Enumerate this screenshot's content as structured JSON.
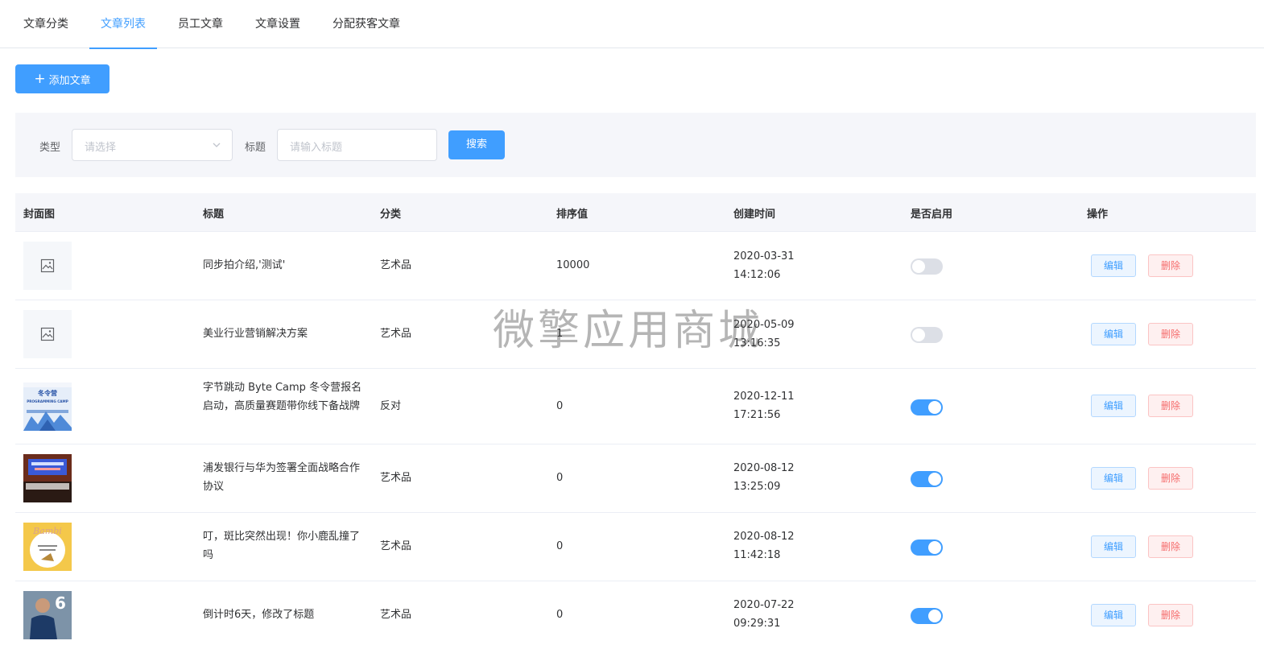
{
  "tabs": [
    {
      "label": "文章分类",
      "active": false
    },
    {
      "label": "文章列表",
      "active": true
    },
    {
      "label": "员工文章",
      "active": false
    },
    {
      "label": "文章设置",
      "active": false
    },
    {
      "label": "分配获客文章",
      "active": false
    }
  ],
  "toolbar": {
    "add_label": "添加文章",
    "add_icon": "plus-icon"
  },
  "filter": {
    "type_label": "类型",
    "type_placeholder": "请选择",
    "title_label": "标题",
    "title_placeholder": "请输入标题",
    "search_label": "搜索"
  },
  "table": {
    "columns": [
      "封面图",
      "标题",
      "分类",
      "排序值",
      "创建时间",
      "是否启用",
      "操作"
    ],
    "rows": [
      {
        "cover": "image-placeholder-icon",
        "title": "同步拍介绍,'测试'",
        "category": "艺术品",
        "sort": "10000",
        "date": "2020-03-31",
        "time": "14:12:06",
        "enabled": false
      },
      {
        "cover": "image-placeholder-icon",
        "title": "美业行业营销解决方案",
        "category": "艺术品",
        "sort": "1",
        "date": "2020-05-09",
        "time": "13:16:35",
        "enabled": false
      },
      {
        "cover": "photo-thumbnail",
        "title": "字节跳动 Byte Camp 冬令营报名启动，高质量赛题带你线下备战牌",
        "category": "反对",
        "sort": "0",
        "date": "2020-12-11",
        "time": "17:21:56",
        "enabled": true
      },
      {
        "cover": "photo-thumbnail",
        "title": "浦发银行与华为签署全面战略合作协议",
        "category": "艺术品",
        "sort": "0",
        "date": "2020-08-12",
        "time": "13:25:09",
        "enabled": true
      },
      {
        "cover": "photo-thumbnail",
        "title": "叮，斑比突然出现！你小鹿乱撞了吗",
        "category": "艺术品",
        "sort": "0",
        "date": "2020-08-12",
        "time": "11:42:18",
        "enabled": true
      },
      {
        "cover": "photo-thumbnail",
        "title": "倒计时6天，修改了标题",
        "category": "艺术品",
        "sort": "0",
        "date": "2020-07-22",
        "time": "09:29:31",
        "enabled": true
      }
    ],
    "edit_label": "编辑",
    "delete_label": "删除"
  },
  "thumb_text": {
    "row3_title": "冬令营",
    "row3_sub": "PROGRAMMING CAMP",
    "row5_brand": "Bambi",
    "row6_number": "6"
  },
  "watermark": "微擎应用商城",
  "colors": {
    "primary": "#409eff",
    "danger": "#f56c6c",
    "header_bg": "#f5f6fa",
    "switch_off": "#dcdfe6"
  }
}
